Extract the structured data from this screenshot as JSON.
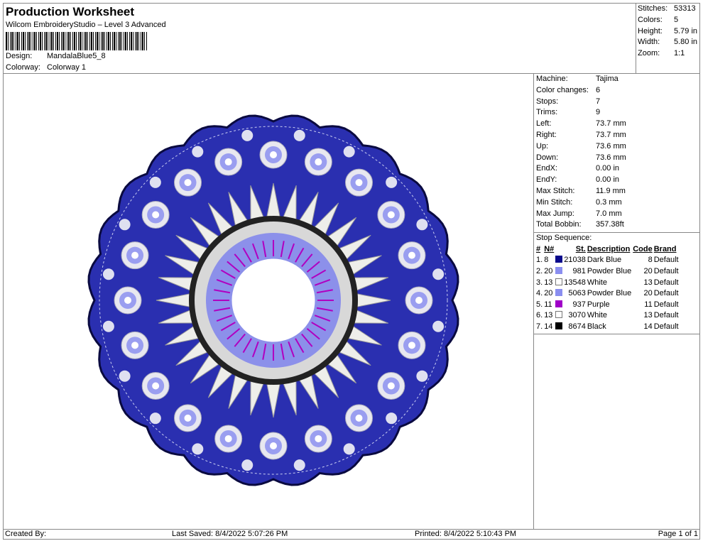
{
  "header": {
    "title": "Production Worksheet",
    "subtitle": "Wilcom EmbroideryStudio – Level 3 Advanced",
    "design_label": "Design:",
    "design": "MandalaBlue5_8",
    "colorway_label": "Colorway:",
    "colorway": "Colorway 1"
  },
  "stats": [
    {
      "k": "Stitches:",
      "v": "53313"
    },
    {
      "k": "Colors:",
      "v": "5"
    },
    {
      "k": "Height:",
      "v": "5.79 in"
    },
    {
      "k": "Width:",
      "v": "5.80 in"
    },
    {
      "k": "Zoom:",
      "v": "1:1"
    }
  ],
  "machine": [
    {
      "k": "Machine:",
      "v": "Tajima"
    },
    {
      "k": "Color changes:",
      "v": "6"
    },
    {
      "k": "Stops:",
      "v": "7"
    },
    {
      "k": "Trims:",
      "v": "9"
    },
    {
      "k": "Left:",
      "v": "73.7 mm"
    },
    {
      "k": "Right:",
      "v": "73.7 mm"
    },
    {
      "k": "Up:",
      "v": "73.6 mm"
    },
    {
      "k": "Down:",
      "v": "73.6 mm"
    },
    {
      "k": "EndX:",
      "v": "0.00 in"
    },
    {
      "k": "EndY:",
      "v": "0.00 in"
    },
    {
      "k": "Max Stitch:",
      "v": "11.9 mm"
    },
    {
      "k": "Min Stitch:",
      "v": "0.3 mm"
    },
    {
      "k": "Max Jump:",
      "v": "7.0 mm"
    },
    {
      "k": "Total Bobbin:",
      "v": "357.38ft"
    }
  ],
  "sequence": {
    "title": "Stop Sequence:",
    "cols": [
      "#",
      "N#",
      "St.",
      "Description",
      "Code",
      "Brand"
    ],
    "rows": [
      {
        "n": "1.",
        "nn": "8",
        "color": "#0a0a8c",
        "st": "21038",
        "desc": "Dark Blue",
        "code": "8",
        "brand": "Default"
      },
      {
        "n": "2.",
        "nn": "20",
        "color": "#8a8ef0",
        "st": "981",
        "desc": "Powder Blue",
        "code": "20",
        "brand": "Default"
      },
      {
        "n": "3.",
        "nn": "13",
        "color": "#ffffff",
        "st": "13548",
        "desc": "White",
        "code": "13",
        "brand": "Default"
      },
      {
        "n": "4.",
        "nn": "20",
        "color": "#8a8ef0",
        "st": "5063",
        "desc": "Powder Blue",
        "code": "20",
        "brand": "Default"
      },
      {
        "n": "5.",
        "nn": "11",
        "color": "#a000c8",
        "st": "937",
        "desc": "Purple",
        "code": "11",
        "brand": "Default"
      },
      {
        "n": "6.",
        "nn": "13",
        "color": "#ffffff",
        "st": "3070",
        "desc": "White",
        "code": "13",
        "brand": "Default"
      },
      {
        "n": "7.",
        "nn": "14",
        "color": "#000000",
        "st": "8674",
        "desc": "Black",
        "code": "14",
        "brand": "Default"
      }
    ]
  },
  "footer": {
    "created": "Created By:",
    "saved": "Last Saved: 8/4/2022 5:07:26 PM",
    "printed": "Printed: 8/4/2022 5:10:43 PM",
    "page": "Page 1 of 1"
  }
}
